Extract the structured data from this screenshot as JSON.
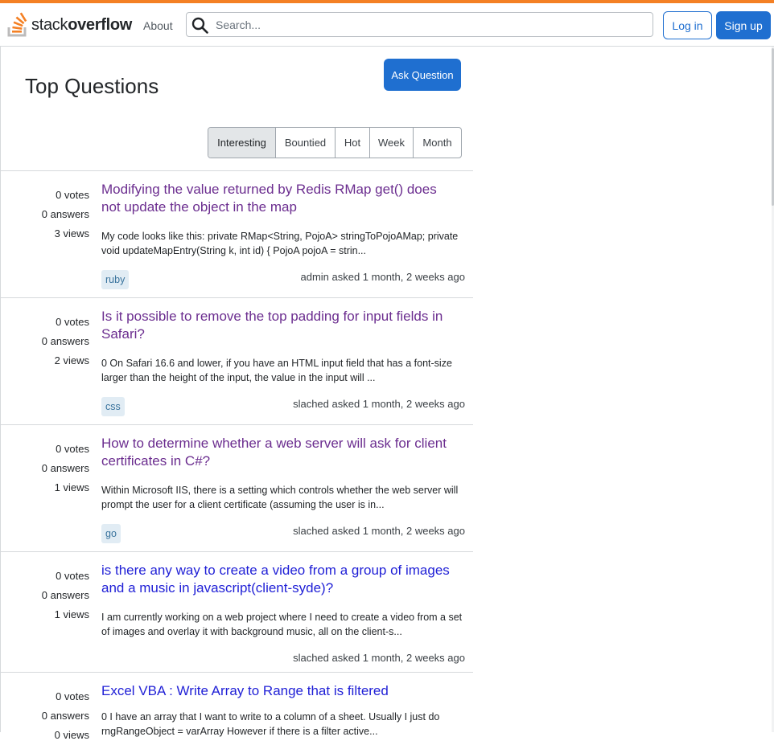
{
  "colors": {
    "accent": "#f48024",
    "primary_button": "#1f6fd0",
    "visited_link": "#6b2d8f",
    "link": "#1f1fd6",
    "tag_bg": "#e1ecf4",
    "tag_text": "#39739d"
  },
  "header": {
    "logo_text_light": "stack",
    "logo_text_bold": "overflow",
    "logo_icon": "stackoverflow-logo-icon",
    "about": "About",
    "search_placeholder": "Search...",
    "search_icon": "search-icon",
    "login": "Log in",
    "signup": "Sign up"
  },
  "main": {
    "title": "Top Questions",
    "ask_button": "Ask Question",
    "filters": [
      "Interesting",
      "Bountied",
      "Hot",
      "Week",
      "Month"
    ],
    "active_filter": "Interesting"
  },
  "questions": [
    {
      "votes": "0 votes",
      "answers": "0 answers",
      "views": "3 views",
      "title": "Modifying the value returned by Redis RMap get() does not update the object in the map",
      "visited": true,
      "excerpt": "My code looks like this: private RMap<String, PojoA> stringToPojoAMap; private void updateMapEntry(String k, int id) { PojoA pojoA = strin...",
      "tag": "ruby",
      "meta": "admin asked 1 month, 2 weeks ago"
    },
    {
      "votes": "0 votes",
      "answers": "0 answers",
      "views": "2 views",
      "title": "Is it possible to remove the top padding for input fields in Safari?",
      "visited": true,
      "excerpt": "0 On Safari 16.6 and lower, if you have an HTML input field that has a font-size larger than the height of the input, the value in the input will ...",
      "tag": "css",
      "meta": "slached asked 1 month, 2 weeks ago"
    },
    {
      "votes": "0 votes",
      "answers": "0 answers",
      "views": "1 views",
      "title": "How to determine whether a web server will ask for client certificates in C#?",
      "visited": true,
      "excerpt": "Within Microsoft IIS, there is a setting which controls whether the web server will prompt the user for a client certificate (assuming the user is in...",
      "tag": "go",
      "meta": "slached asked 1 month, 2 weeks ago"
    },
    {
      "votes": "0 votes",
      "answers": "0 answers",
      "views": "1 views",
      "title": "is there any way to create a video from a group of images and a music in javascript(client-syde)?",
      "visited": false,
      "excerpt": "I am currently working on a web project where I need to create a video from a set of images and overlay it with background music, all on the client-s...",
      "tag": "",
      "meta": "slached asked 1 month, 2 weeks ago"
    },
    {
      "votes": "0 votes",
      "answers": "0 answers",
      "views": "0 views",
      "title": "Excel VBA : Write Array to Range that is filtered",
      "visited": false,
      "excerpt": "0 I have an array that I want to write to a column of a sheet. Usually I just do rngRangeObject = varArray However if there is a filter active...",
      "tag": "",
      "meta": ""
    }
  ]
}
